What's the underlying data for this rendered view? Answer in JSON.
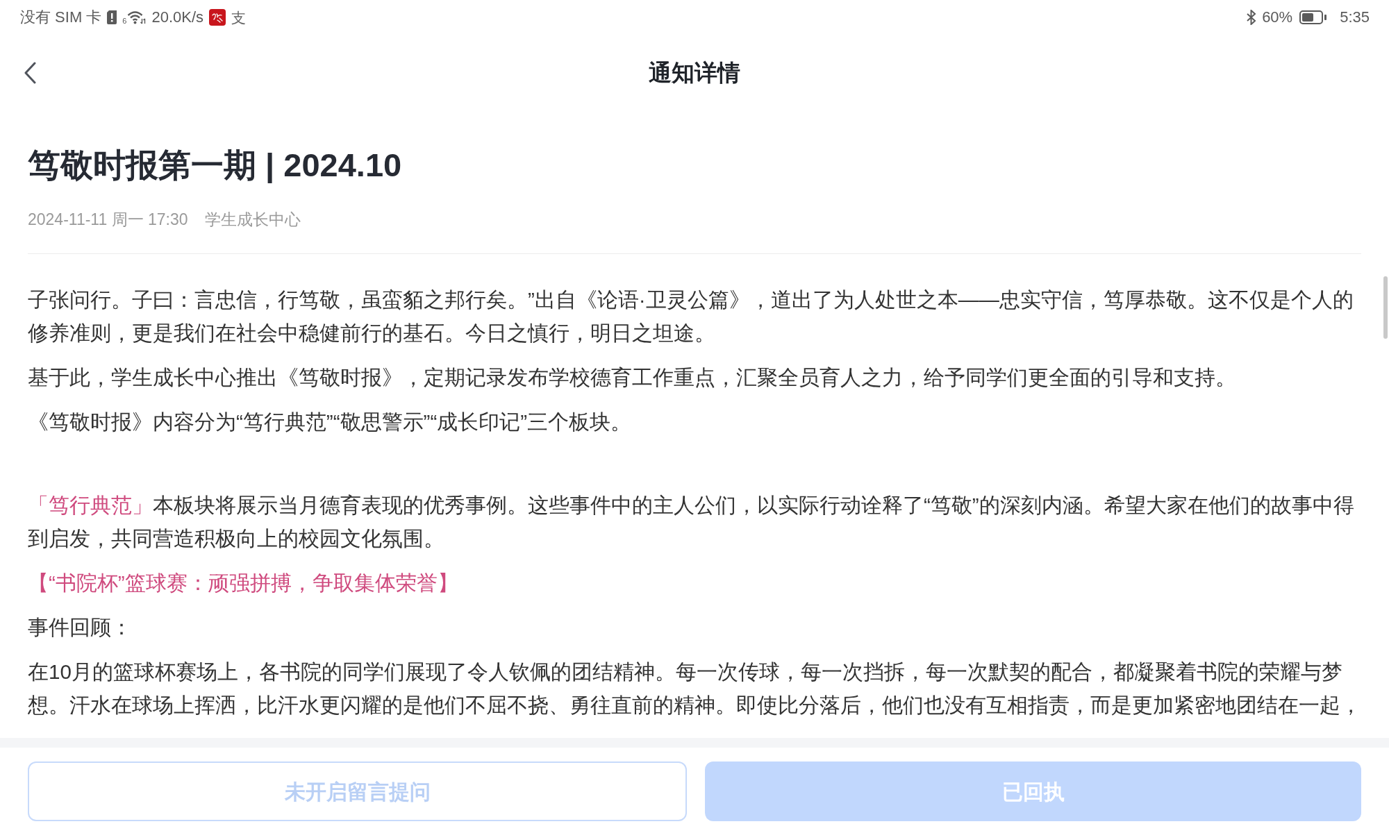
{
  "status_bar": {
    "carrier": "没有 SIM 卡",
    "wifi_badge": "6",
    "speed": "20.0K/s",
    "app_glyph": "支",
    "battery": "60%",
    "time": "5:35"
  },
  "nav": {
    "title": "通知详情"
  },
  "article": {
    "title": "笃敬时报第一期 | 2024.10",
    "date": "2024-11-11 周一 17:30",
    "source": "学生成长中心",
    "paragraphs": [
      {
        "kind": "text",
        "text": "子张问行。子曰：言忠信，行笃敬，虽蛮貊之邦行矣。”出自《论语·卫灵公篇》，道出了为人处世之本——忠实守信，笃厚恭敬。这不仅是个人的修养准则，更是我们在社会中稳健前行的基石。今日之慎行，明日之坦途。"
      },
      {
        "kind": "text",
        "text": "基于此，学生成长中心推出《笃敬时报》，定期记录发布学校德育工作重点，汇聚全员育人之力，给予同学们更全面的引导和支持。"
      },
      {
        "kind": "text",
        "text": "《笃敬时报》内容分为“笃行典范”“敬思警示”“成长印记”三个板块。"
      },
      {
        "kind": "section",
        "label": "「笃行典范」",
        "text": "本板块将展示当月德育表现的优秀事例。这些事件中的主人公们，以实际行动诠释了“笃敬”的深刻内涵。希望大家在他们的故事中得到启发，共同营造积极向上的校园文化氛围。"
      },
      {
        "kind": "heading",
        "text": "【“书院杯”篮球赛：顽强拼搏，争取集体荣誉】"
      },
      {
        "kind": "text",
        "text": "事件回顾："
      },
      {
        "kind": "text",
        "text": "在10月的篮球杯赛场上，各书院的同学们展现了令人钦佩的团结精神。每一次传球，每一次挡拆，每一次默契的配合，都凝聚着书院的荣耀与梦想。汗水在球场上挥洒，比汗水更闪耀的是他们不屈不挠、勇往直前的精神。即使比分落后，他们也没有互相指责，而是更加紧密地团结在一起，"
      }
    ]
  },
  "buttons": [
    {
      "label": "未开启留言提问",
      "kind": "outline",
      "disabled": true
    },
    {
      "label": "已回执",
      "kind": "filled",
      "disabled": true
    }
  ]
}
